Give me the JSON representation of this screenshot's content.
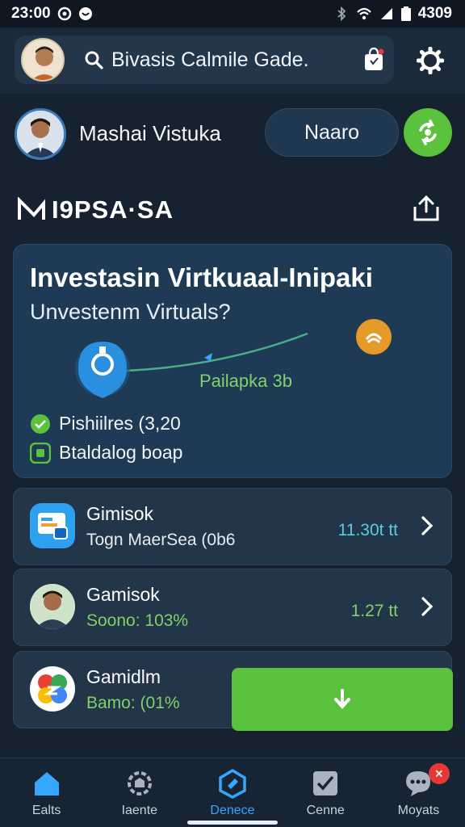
{
  "status_bar": {
    "time": "23:00",
    "battery_text": "4309"
  },
  "header": {
    "search_text": "Bivasis Calmile Gade.",
    "icons": [
      "search-icon",
      "bag-icon",
      "gear-icon"
    ]
  },
  "profile": {
    "name": "Mashai Vistuka",
    "button_label": "Naaro",
    "action_icon": "refresh-icon"
  },
  "section": {
    "title": "I9PSA·SA",
    "share_icon": "share-icon"
  },
  "card": {
    "title": "Investasin Virtkuaal-Inipaki",
    "subtitle": "Unvestenm Virtuals?",
    "chart_label": "Pailapka 3b",
    "check_rows": [
      "Pishiilres (3,20",
      "Btaldalog boap"
    ]
  },
  "list": [
    {
      "title": "Gimisok",
      "subtitle": "Togn MaerSea (0b6",
      "value": "11.30t tt",
      "value_color": "#5ccbe0"
    },
    {
      "title": "Gamisok",
      "subtitle": "Soono: 103%",
      "value": "1.27 tt",
      "value_color": "#7fd26a"
    },
    {
      "title": "Gamidlm",
      "subtitle": "Bamo: (01%"
    }
  ],
  "bottom_nav": {
    "items": [
      {
        "label": "Ealts",
        "icon": "home-icon"
      },
      {
        "label": "Iaente",
        "icon": "gear-shield-icon"
      },
      {
        "label": "Denece",
        "icon": "diamond-icon"
      },
      {
        "label": "Cenne",
        "icon": "checklist-icon"
      },
      {
        "label": "Moyats",
        "icon": "chat-icon",
        "badge": "⨯"
      }
    ],
    "active_index": 2
  },
  "colors": {
    "accent_green": "#5ac23c",
    "accent_blue": "#35a7ff",
    "background": "#172230",
    "card": "#1f3a54"
  }
}
